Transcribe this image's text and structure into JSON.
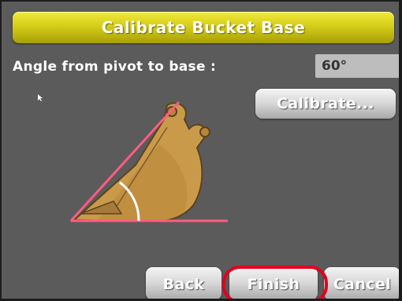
{
  "dialog": {
    "title": "Calibrate Bucket Base"
  },
  "angle": {
    "label": "Angle from pivot to base :",
    "value": "60°"
  },
  "buttons": {
    "calibrate": "Calibrate...",
    "back": "Back",
    "finish": "Finish",
    "cancel": "Cancel"
  },
  "colors": {
    "title_bar": "#d5cd18",
    "screen_bg": "#5b5b5b",
    "bucket_fill": "#c99a4a",
    "guide_lines": "#ff5c82",
    "highlight_ring": "#e3001e"
  },
  "icons": {
    "pointer": "mouse-pointer-icon",
    "bucket": "excavator-bucket-icon"
  }
}
